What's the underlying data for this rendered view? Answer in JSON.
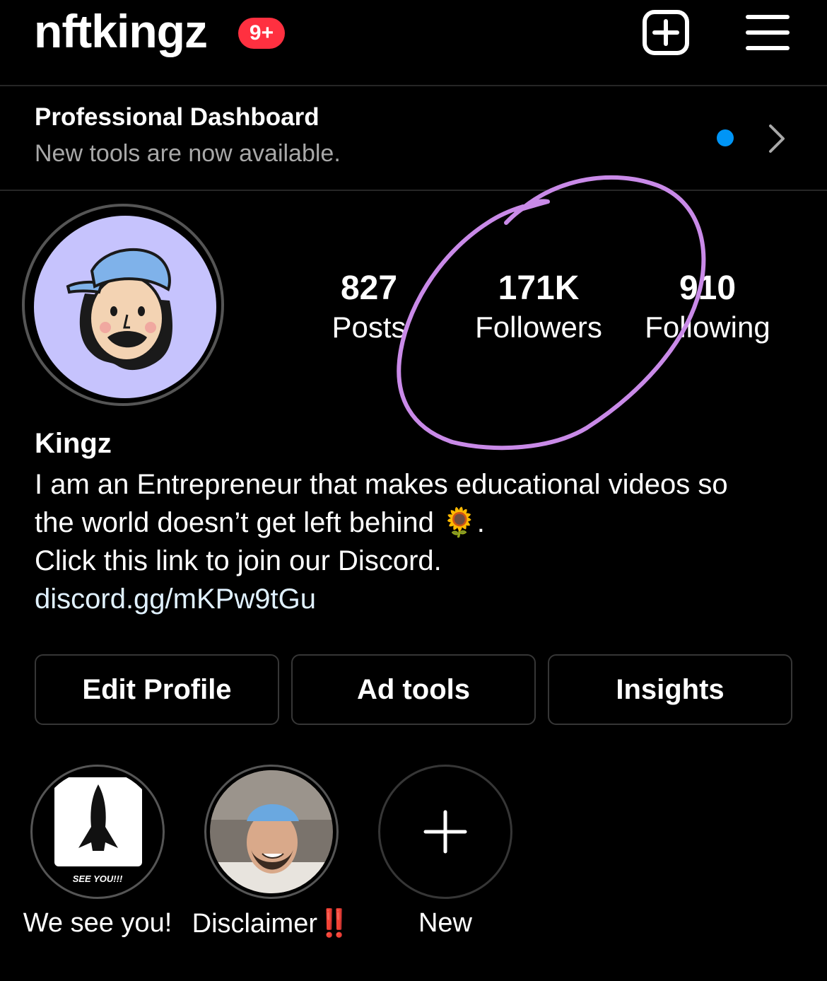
{
  "header": {
    "username": "nftkingz",
    "notification_badge": "9+",
    "icons": [
      "add-post-icon",
      "menu-icon"
    ]
  },
  "dashboard": {
    "title": "Professional Dashboard",
    "subtitle": "New tools are now available.",
    "dot_color": "#0095f6"
  },
  "stats": [
    {
      "value": "827",
      "label": "Posts"
    },
    {
      "value": "171K",
      "label": "Followers"
    },
    {
      "value": "910",
      "label": "Following"
    }
  ],
  "profile": {
    "name": "Kingz",
    "bio_line1": "I am an Entrepreneur that makes educational videos so",
    "bio_line2": "the world doesn’t get left behind",
    "bio_emoji": "🌻",
    "bio_line2_end": ".",
    "bio_line3": "Click this link to join our Discord.",
    "link": "discord.gg/mKPw9tGu"
  },
  "buttons": [
    "Edit Profile",
    "Ad tools",
    "Insights"
  ],
  "highlights": [
    {
      "label": "We see you!",
      "caption": "SEE YOU!!!"
    },
    {
      "label": "Disclaimer",
      "suffix": "‼️"
    },
    {
      "label": "New"
    }
  ],
  "colors": {
    "badge": "#ff3040",
    "annotation_circle": "#c98ae8",
    "avatar_bg": "#c6c3fd",
    "link": "#e0f1ff"
  }
}
